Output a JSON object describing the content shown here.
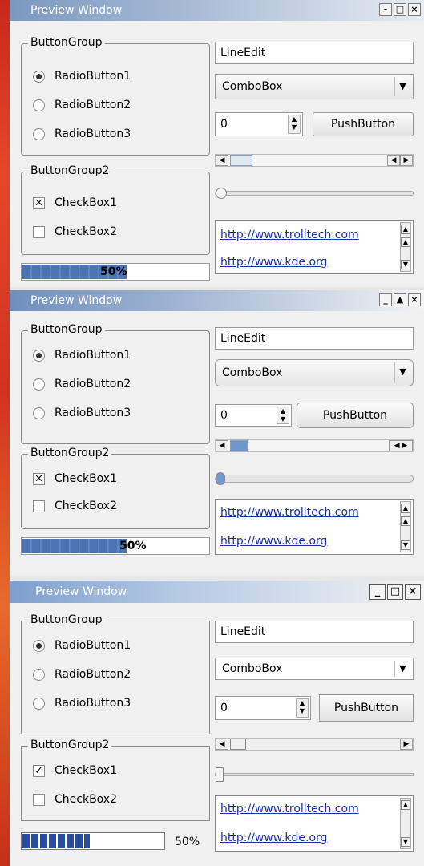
{
  "windows": [
    {
      "title": "Preview Window",
      "title_buttons": [
        "-",
        "□",
        "×"
      ],
      "button_group": {
        "label": "ButtonGroup",
        "radios": [
          {
            "label": "RadioButton1",
            "checked": true
          },
          {
            "label": "RadioButton2",
            "checked": false
          },
          {
            "label": "RadioButton3",
            "checked": false
          }
        ]
      },
      "button_group2": {
        "label": "ButtonGroup2",
        "checks": [
          {
            "label": "CheckBox1",
            "checked": true
          },
          {
            "label": "CheckBox2",
            "checked": false
          }
        ]
      },
      "line_edit": "LineEdit",
      "combo_box": "ComboBox",
      "spin_value": "0",
      "push_button": "PushButton",
      "list_items": [
        "http://www.trolltech.com",
        "http://www.kde.org"
      ],
      "progress": {
        "value": 0.5,
        "label": "50%"
      }
    },
    {
      "title": "Preview Window",
      "title_buttons": [
        "_",
        "▲",
        "×"
      ],
      "button_group": {
        "label": "ButtonGroup",
        "radios": [
          {
            "label": "RadioButton1",
            "checked": true
          },
          {
            "label": "RadioButton2",
            "checked": false
          },
          {
            "label": "RadioButton3",
            "checked": false
          }
        ]
      },
      "button_group2": {
        "label": "ButtonGroup2",
        "checks": [
          {
            "label": "CheckBox1",
            "checked": true
          },
          {
            "label": "CheckBox2",
            "checked": false
          }
        ]
      },
      "line_edit": "LineEdit",
      "combo_box": "ComboBox",
      "spin_value": "0",
      "push_button": "PushButton",
      "list_items": [
        "http://www.trolltech.com",
        "http://www.kde.org"
      ],
      "progress": {
        "value": 0.5,
        "label": "50%"
      }
    },
    {
      "title": "Preview Window",
      "title_buttons": [
        "_",
        "□",
        "×"
      ],
      "button_group": {
        "label": "ButtonGroup",
        "radios": [
          {
            "label": "RadioButton1",
            "checked": true
          },
          {
            "label": "RadioButton2",
            "checked": false
          },
          {
            "label": "RadioButton3",
            "checked": false
          }
        ]
      },
      "button_group2": {
        "label": "ButtonGroup2",
        "checks": [
          {
            "label": "CheckBox1",
            "checked": true
          },
          {
            "label": "CheckBox2",
            "checked": false
          }
        ]
      },
      "line_edit": "LineEdit",
      "combo_box": "ComboBox",
      "spin_value": "0",
      "push_button": "PushButton",
      "list_items": [
        "http://www.trolltech.com",
        "http://www.kde.org"
      ],
      "progress": {
        "value": 0.5,
        "label": "50%"
      }
    }
  ]
}
